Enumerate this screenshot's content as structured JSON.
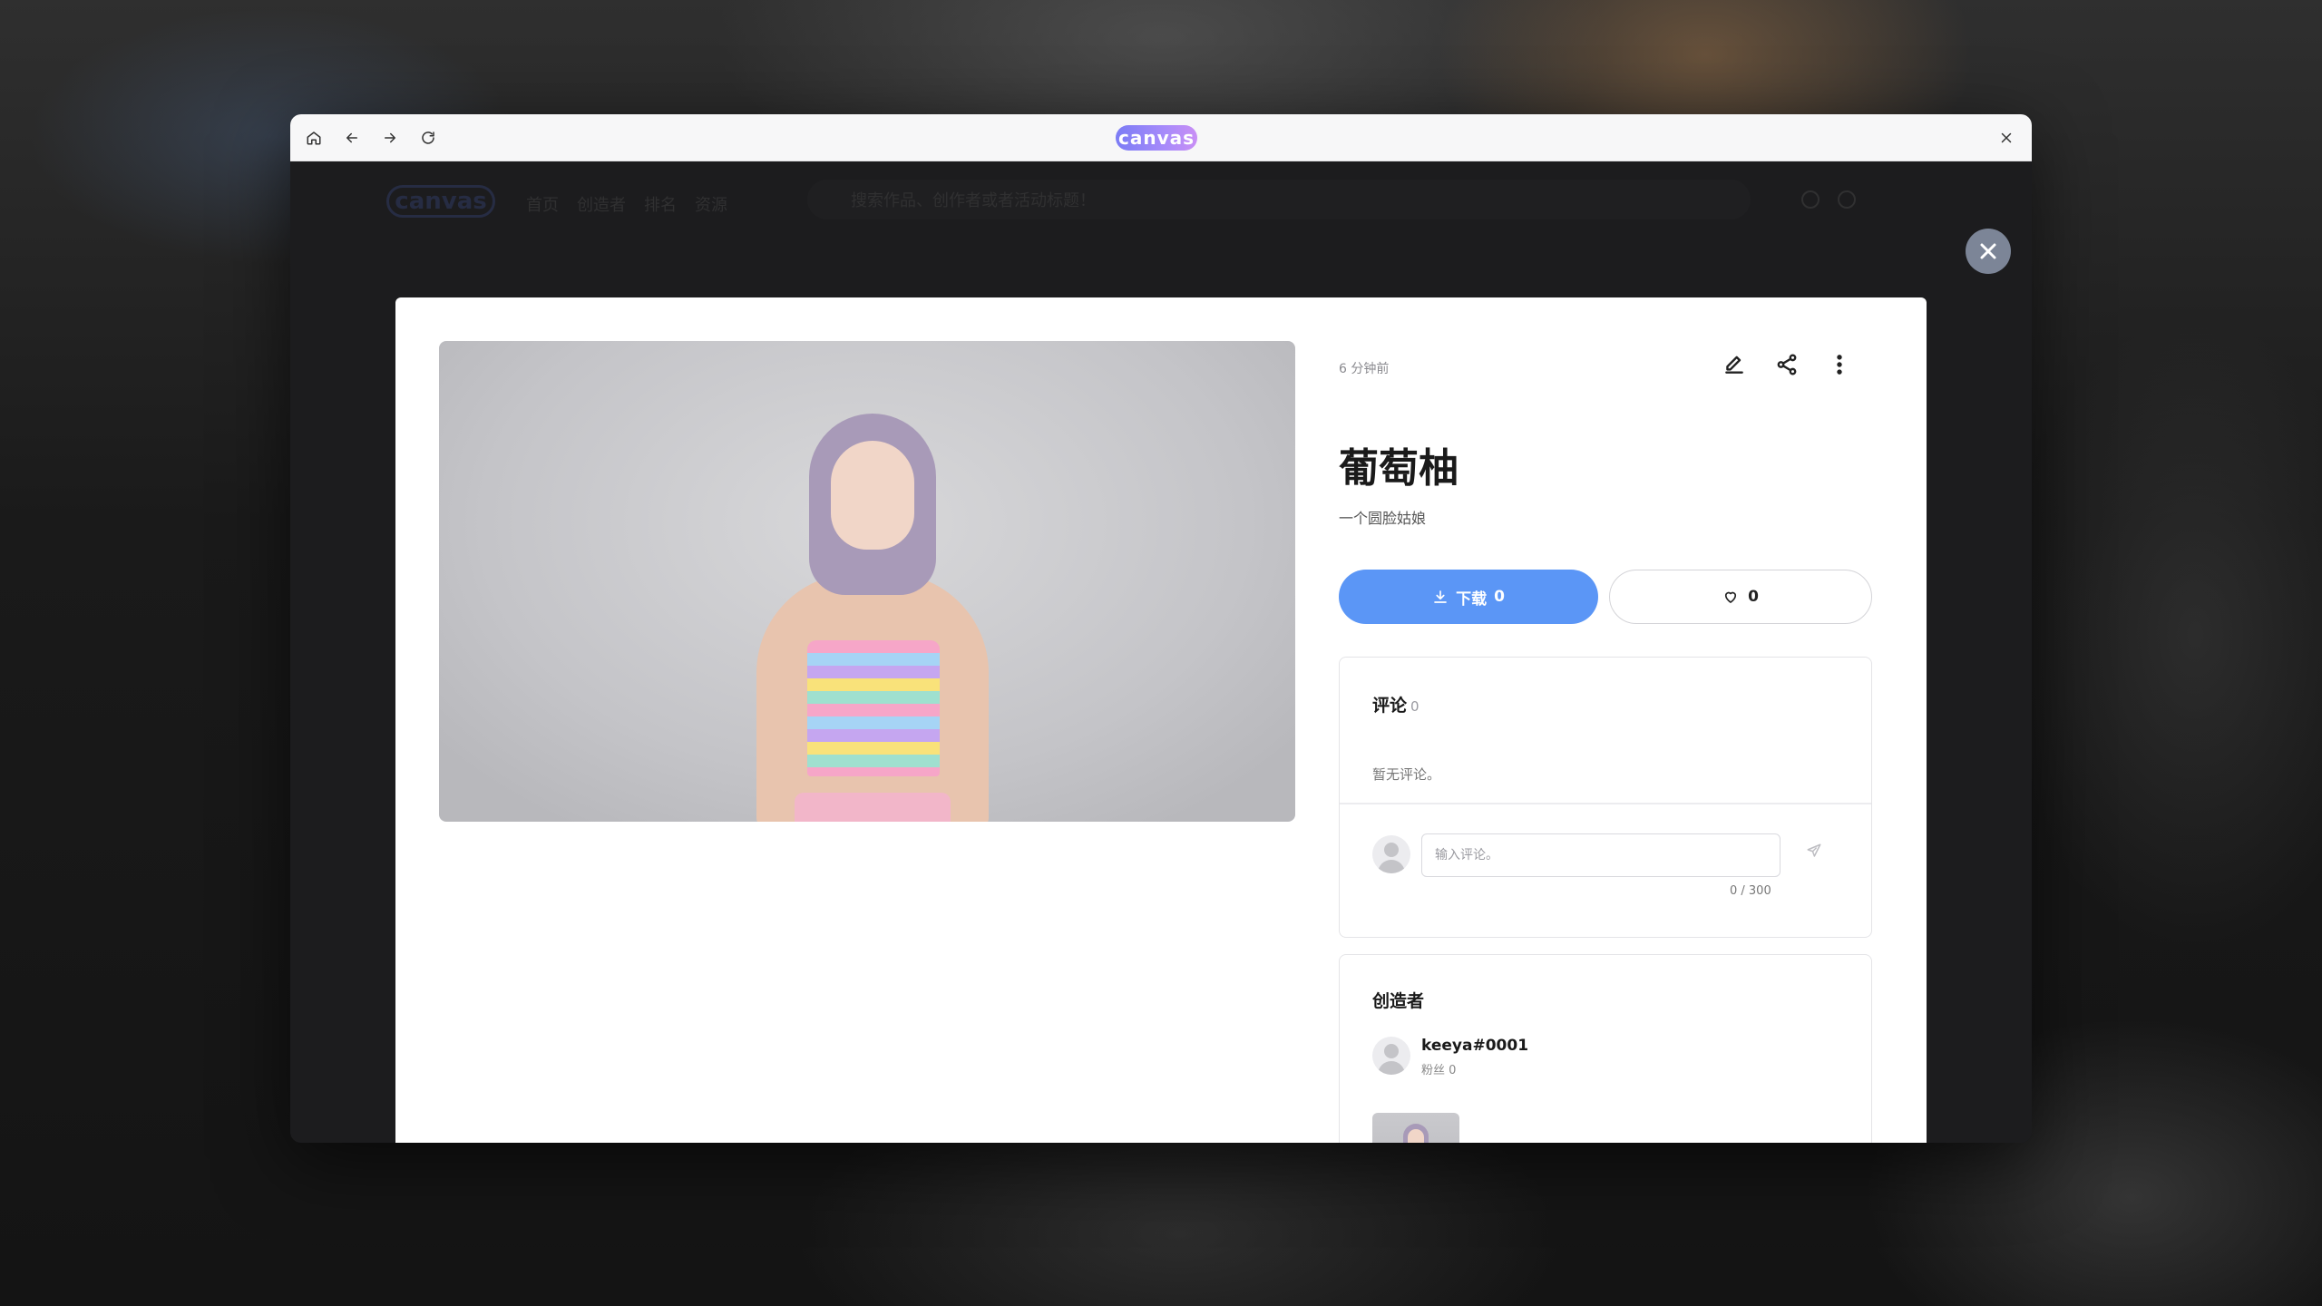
{
  "browser": {
    "logo_text": "canvas"
  },
  "app_header": {
    "logo_text": "canvas",
    "nav": [
      "首页",
      "创造者",
      "排名",
      "资源"
    ],
    "search_placeholder": "搜索作品、创作者或者活动标题！"
  },
  "post": {
    "timestamp": "6 分钟前",
    "title": "葡萄柚",
    "description": "一个圆脸姑娘",
    "download_label": "下载",
    "download_count": "0",
    "like_count": "0"
  },
  "comments": {
    "title": "评论",
    "count": "0",
    "empty_text": "暂无评论。",
    "input_placeholder": "输入评论。",
    "char_count": "0 / 300"
  },
  "creator": {
    "title": "创造者",
    "name": "keeya#0001",
    "fans": "粉丝 0"
  },
  "colors": {
    "accent": "#5b96f6",
    "modal_close_bg": "#7c8597"
  }
}
